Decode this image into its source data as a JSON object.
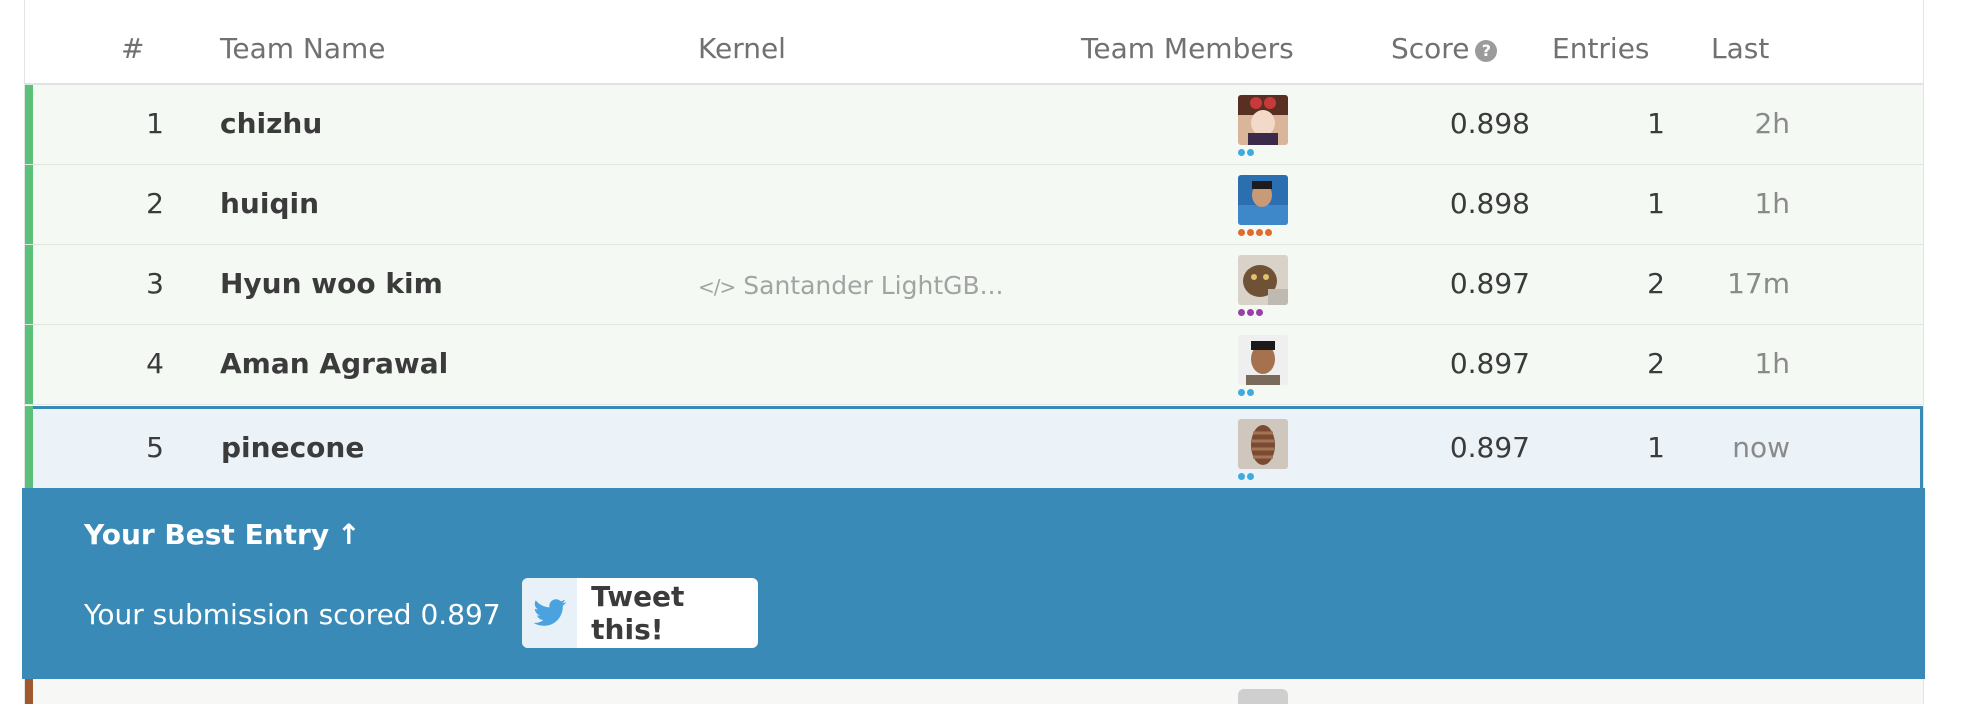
{
  "columns": {
    "rank": "#",
    "team": "Team Name",
    "kernel": "Kernel",
    "members": "Team Members",
    "score": "Score",
    "entries": "Entries",
    "last": "Last"
  },
  "rows": [
    {
      "rank": "1",
      "team": "chizhu",
      "kernel": "",
      "score": "0.898",
      "entries": "1",
      "last": "2h",
      "tier_color": "#3fa9e0",
      "tier_dots": 2
    },
    {
      "rank": "2",
      "team": "huiqin",
      "kernel": "",
      "score": "0.898",
      "entries": "1",
      "last": "1h",
      "tier_color": "#e06b2c",
      "tier_dots": 4
    },
    {
      "rank": "3",
      "team": "Hyun woo kim",
      "kernel": "Santander LightGB...",
      "score": "0.897",
      "entries": "2",
      "last": "17m",
      "tier_color": "#9c3ea8",
      "tier_dots": 3
    },
    {
      "rank": "4",
      "team": "Aman Agrawal",
      "kernel": "",
      "score": "0.897",
      "entries": "2",
      "last": "1h",
      "tier_color": "#3fa9e0",
      "tier_dots": 2
    },
    {
      "rank": "5",
      "team": "pinecone",
      "kernel": "",
      "score": "0.897",
      "entries": "1",
      "last": "now",
      "tier_color": "#3fa9e0",
      "tier_dots": 2
    }
  ],
  "banner": {
    "title": "Your Best Entry",
    "message": "Your submission scored 0.897",
    "tweet_label": "Tweet this!"
  },
  "colors": {
    "accent_blue": "#3a8ab8",
    "rank_green": "#5bc07a",
    "rank_bronze": "#a0582f"
  }
}
